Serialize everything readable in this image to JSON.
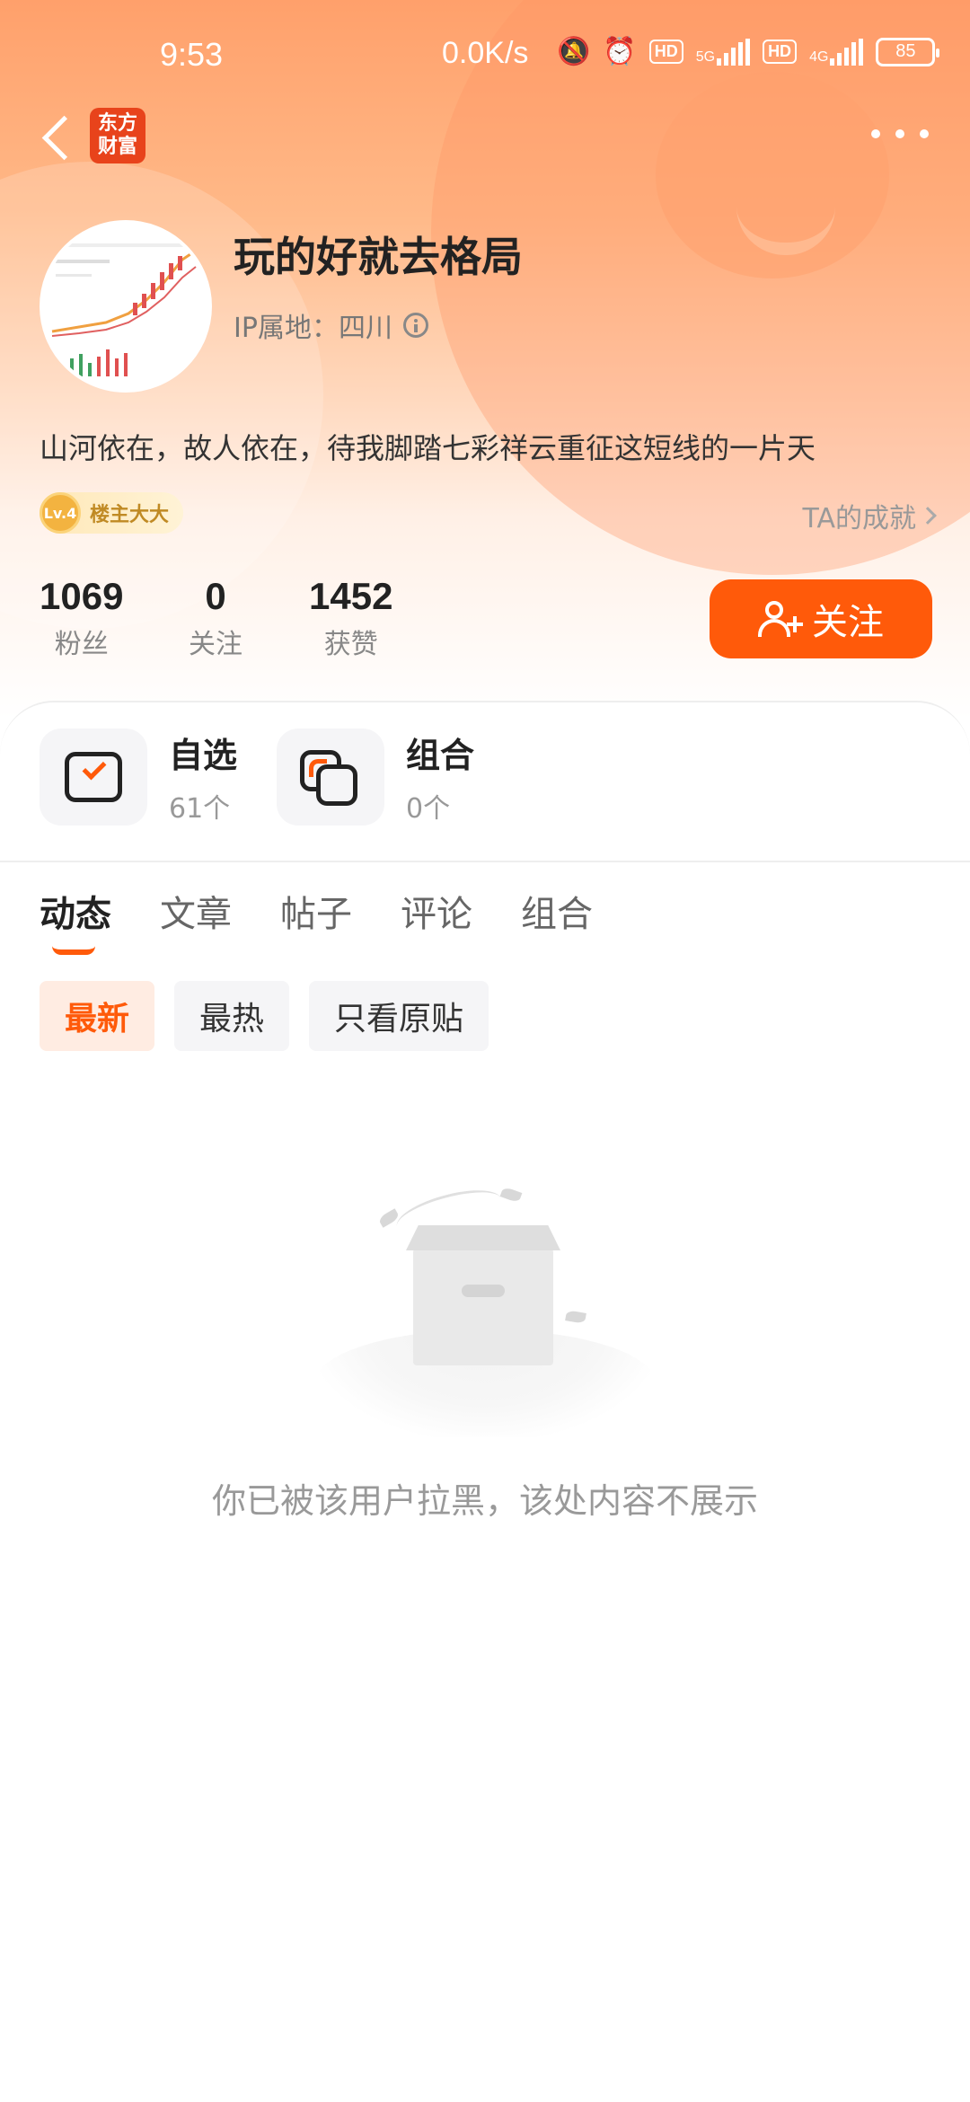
{
  "status_bar": {
    "time": "9:53",
    "net_speed": "0.0K/s",
    "hd1": "HD",
    "sig1": "5G",
    "hd2": "HD",
    "sig2": "4G",
    "battery": "85"
  },
  "app": {
    "logo_line1": "东方",
    "logo_line2": "财富"
  },
  "profile": {
    "username": "玩的好就去格局",
    "ip_location": "IP属地：四川",
    "bio": "山河依在，故人依在，待我脚踏七彩祥云重征这短线的一片天",
    "badge_level": "Lv.4",
    "badge_title": "楼主大大",
    "achievements_link": "TA的成就"
  },
  "stats": [
    {
      "value": "1069",
      "label": "粉丝"
    },
    {
      "value": "0",
      "label": "关注"
    },
    {
      "value": "1452",
      "label": "获赞"
    }
  ],
  "follow_button": "关注",
  "features": [
    {
      "title": "自选",
      "subtitle": "61个",
      "icon": "checked-box-icon"
    },
    {
      "title": "组合",
      "subtitle": "0个",
      "icon": "stacked-squares-icon"
    }
  ],
  "tabs": [
    "动态",
    "文章",
    "帖子",
    "评论",
    "组合"
  ],
  "active_tab": "动态",
  "filters": [
    "最新",
    "最热",
    "只看原贴"
  ],
  "active_filter": "最新",
  "empty_message": "你已被该用户拉黑，该处内容不展示",
  "colors": {
    "accent": "#ff5a0a",
    "hero_top": "#ffa06b"
  }
}
